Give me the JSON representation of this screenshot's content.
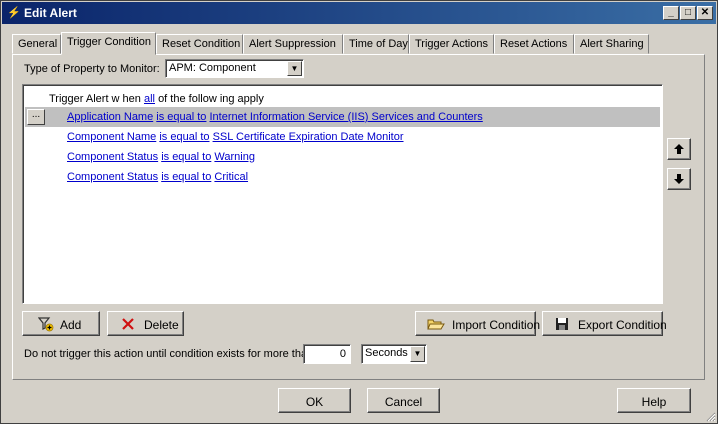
{
  "window": {
    "title": "Edit Alert",
    "minimize": "_",
    "maximize": "□",
    "close": "✕"
  },
  "tabs": [
    {
      "label": "General"
    },
    {
      "label": "Trigger Condition"
    },
    {
      "label": "Reset Condition"
    },
    {
      "label": "Alert Suppression"
    },
    {
      "label": "Time of Day"
    },
    {
      "label": "Trigger Actions"
    },
    {
      "label": "Reset Actions"
    },
    {
      "label": "Alert Sharing"
    }
  ],
  "property": {
    "label": "Type of Property to Monitor:",
    "value": "APM: Component"
  },
  "conditions": {
    "head_prefix": "Trigger Alert w hen",
    "head_link": "all",
    "head_suffix": "of the follow ing apply",
    "ellipsis": "...",
    "rows": [
      {
        "field": "Application Name",
        "op": "is equal to",
        "value": "Internet Information Service (IIS) Services and Counters"
      },
      {
        "field": "Component Name",
        "op": "is equal to",
        "value": "SSL Certificate Expiration Date Monitor"
      },
      {
        "field": "Component Status",
        "op": "is equal to",
        "value": "Warning"
      },
      {
        "field": "Component Status",
        "op": "is equal to",
        "value": "Critical"
      }
    ]
  },
  "actions": {
    "add": "Add",
    "delete": "Delete",
    "import": "Import Condition",
    "export": "Export Condition"
  },
  "delay": {
    "label": "Do not trigger this action until condition exists for more than",
    "value": "0",
    "unit": "Seconds"
  },
  "footer": {
    "ok": "OK",
    "cancel": "Cancel",
    "help": "Help"
  }
}
